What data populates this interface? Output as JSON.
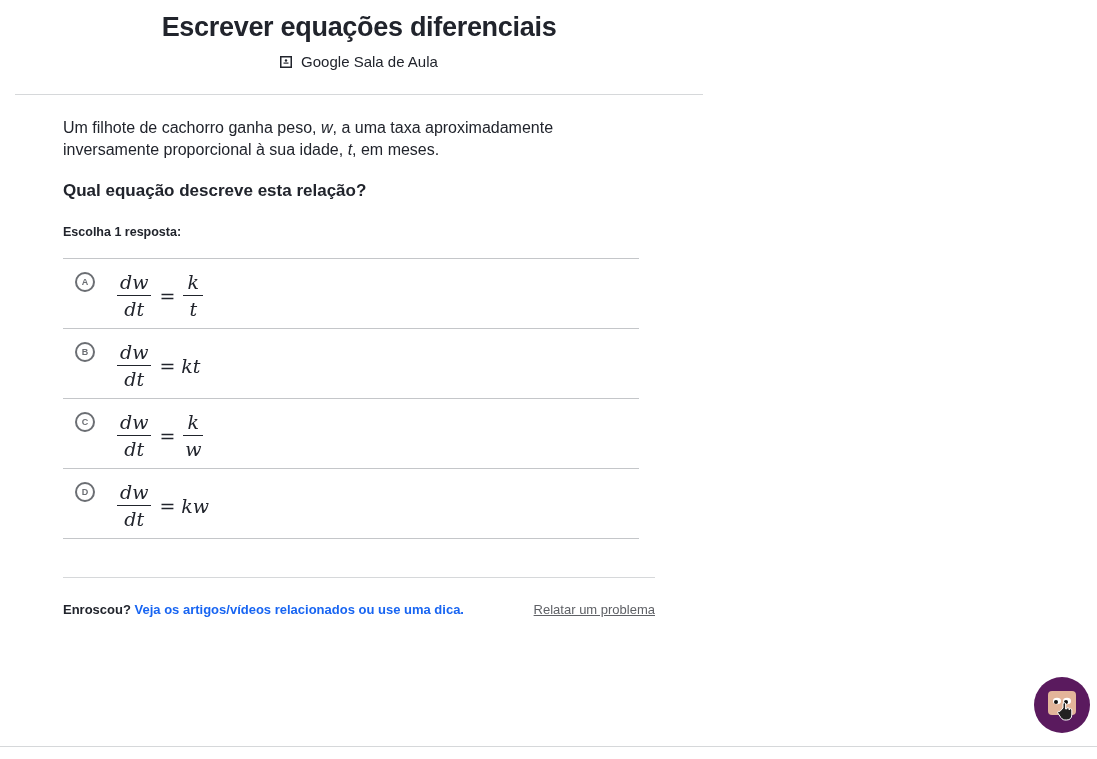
{
  "header": {
    "title": "Escrever equações diferenciais",
    "source": "Google Sala de Aula"
  },
  "question": {
    "intro": "Um filhote de cachorro ganha peso, *w*, a uma taxa aproximadamente inversamente proporcional à sua idade, *t*, em meses.",
    "prompt": "Qual equação descreve esta relação?",
    "instruction": "Escolha 1 resposta:"
  },
  "choices": [
    {
      "letter": "A",
      "selected": false,
      "lhs": {
        "numerator": "dw",
        "denominator": "dt"
      },
      "equals": "=",
      "rhs": {
        "kind": "fraction",
        "numerator": "k",
        "denominator": "t"
      }
    },
    {
      "letter": "B",
      "selected": false,
      "lhs": {
        "numerator": "dw",
        "denominator": "dt"
      },
      "equals": "=",
      "rhs": {
        "kind": "plain",
        "text": "kt"
      }
    },
    {
      "letter": "C",
      "selected": false,
      "lhs": {
        "numerator": "dw",
        "denominator": "dt"
      },
      "equals": "=",
      "rhs": {
        "kind": "fraction",
        "numerator": "k",
        "denominator": "w"
      }
    },
    {
      "letter": "D",
      "selected": false,
      "lhs": {
        "numerator": "dw",
        "denominator": "dt"
      },
      "equals": "=",
      "rhs": {
        "kind": "plain",
        "text": "kw"
      }
    }
  ],
  "footer": {
    "stuck_label": "Enroscou?",
    "help_link": "Veja os artigos/vídeos relacionados ou use uma dica.",
    "report_link": "Relatar um problema"
  }
}
